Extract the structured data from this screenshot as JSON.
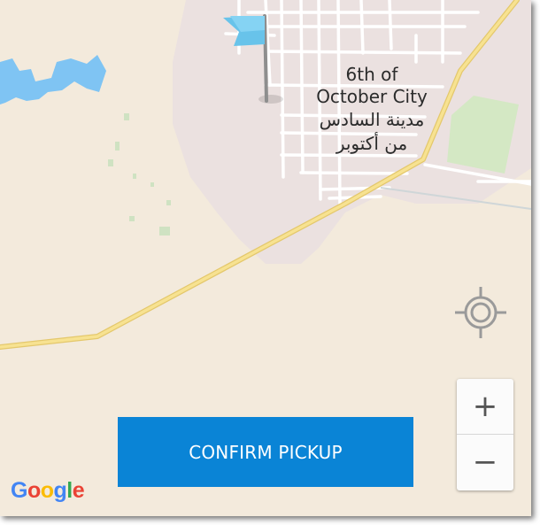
{
  "map": {
    "city_name_en": "6th of October City",
    "city_name_en_line1": "6th of",
    "city_name_en_line2": "October City",
    "city_name_ar_line1": "مدينة السادس",
    "city_name_ar_line2": "من أكتوبر",
    "colors": {
      "land": "#f3eadc",
      "urban": "#ebe1e0",
      "park": "#d4e8c4",
      "water": "#7fc4f3",
      "highway": "#f6df86",
      "street": "#ffffff"
    },
    "marker_icon": "flag-icon"
  },
  "controls": {
    "locate_icon": "crosshair-icon",
    "zoom_in_label": "+",
    "zoom_out_label": "−"
  },
  "action": {
    "confirm_label": "CONFIRM PICKUP",
    "color": "#0a84d6"
  },
  "attribution": {
    "logo_text": "Google",
    "letters": [
      "G",
      "o",
      "o",
      "g",
      "l",
      "e"
    ],
    "letter_colors": [
      "#4285F4",
      "#EA4335",
      "#FBBC05",
      "#4285F4",
      "#34A853",
      "#EA4335"
    ]
  }
}
